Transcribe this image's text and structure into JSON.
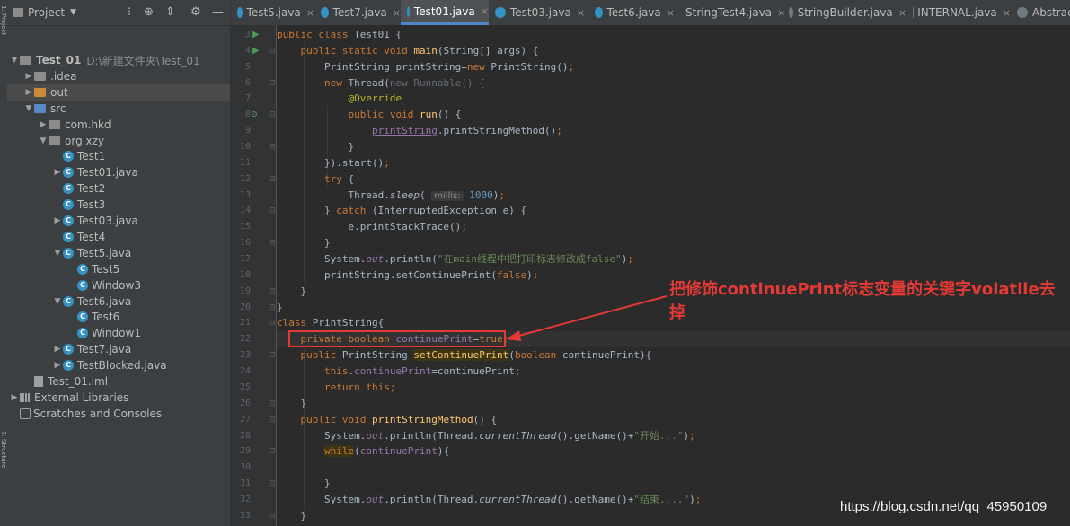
{
  "project_panel": {
    "title": "Project",
    "tree": [
      {
        "label": "Test_01",
        "path": "D:\\新建文件夹\\Test_01",
        "bold": true,
        "depth": 0,
        "expanded": true,
        "icon": "folder-grey"
      },
      {
        "label": ".idea",
        "depth": 1,
        "expanded": false,
        "icon": "folder-grey"
      },
      {
        "label": "out",
        "depth": 1,
        "expanded": false,
        "icon": "folder-orange",
        "selected": true
      },
      {
        "label": "src",
        "depth": 1,
        "expanded": true,
        "icon": "folder-blue"
      },
      {
        "label": "com.hkd",
        "depth": 2,
        "expanded": false,
        "icon": "package"
      },
      {
        "label": "org.xzy",
        "depth": 2,
        "expanded": true,
        "icon": "package"
      },
      {
        "label": "Test1",
        "depth": 3,
        "icon": "class"
      },
      {
        "label": "Test01.java",
        "depth": 3,
        "expanded": false,
        "icon": "class"
      },
      {
        "label": "Test2",
        "depth": 3,
        "icon": "class"
      },
      {
        "label": "Test3",
        "depth": 3,
        "icon": "class"
      },
      {
        "label": "Test03.java",
        "depth": 3,
        "expanded": false,
        "icon": "class"
      },
      {
        "label": "Test4",
        "depth": 3,
        "icon": "class"
      },
      {
        "label": "Test5.java",
        "depth": 3,
        "expanded": true,
        "icon": "class"
      },
      {
        "label": "Test5",
        "depth": 4,
        "icon": "class"
      },
      {
        "label": "Window3",
        "depth": 4,
        "icon": "class"
      },
      {
        "label": "Test6.java",
        "depth": 3,
        "expanded": true,
        "icon": "class"
      },
      {
        "label": "Test6",
        "depth": 4,
        "icon": "class"
      },
      {
        "label": "Window1",
        "depth": 4,
        "icon": "class"
      },
      {
        "label": "Test7.java",
        "depth": 3,
        "expanded": false,
        "icon": "class"
      },
      {
        "label": "TestBlocked.java",
        "depth": 3,
        "expanded": false,
        "icon": "class"
      },
      {
        "label": "Test_01.iml",
        "depth": 1,
        "icon": "iml"
      },
      {
        "label": "External Libraries",
        "depth": 0,
        "expanded": false,
        "icon": "library"
      },
      {
        "label": "Scratches and Consoles",
        "depth": 0,
        "icon": "scratches"
      }
    ]
  },
  "tabs": [
    {
      "label": "Test5.java",
      "active": false
    },
    {
      "label": "Test7.java",
      "active": false
    },
    {
      "label": "Test01.java",
      "active": true
    },
    {
      "label": "Test03.java",
      "active": false
    },
    {
      "label": "Test6.java",
      "active": false
    },
    {
      "label": "StringTest4.java",
      "active": false
    },
    {
      "label": "StringBuilder.java",
      "active": false
    },
    {
      "label": "INTERNAL.java",
      "active": false
    },
    {
      "label": "Abstract",
      "active": false
    }
  ],
  "editor": {
    "current_line": 22,
    "lines": [
      {
        "n": 3,
        "html": "<span class=\"kw\">public class </span>Test01 {"
      },
      {
        "n": 4,
        "html": "    <span class=\"kw\">public static void </span><span class=\"mth\">main</span>(String[] args) {"
      },
      {
        "n": 5,
        "html": "        PrintString printString=<span class=\"kw\">new </span>PrintString()<span class=\"kw\">;</span>"
      },
      {
        "n": 6,
        "html": "        <span class=\"kw\">new </span>Thread(<span class=\"dim\">new Runnable() {</span>"
      },
      {
        "n": 7,
        "html": "            <span class=\"ann\">@Override</span>"
      },
      {
        "n": 8,
        "html": "            <span class=\"kw\">public void </span><span class=\"mth\">run</span>() {"
      },
      {
        "n": 9,
        "html": "                <span class=\"fld u\">printString</span>.printStringMethod()<span class=\"kw\">;</span>"
      },
      {
        "n": 10,
        "html": "            }"
      },
      {
        "n": 11,
        "html": "        }).start()<span class=\"kw\">;</span>"
      },
      {
        "n": 12,
        "html": "        <span class=\"kw\">try </span>{"
      },
      {
        "n": 13,
        "html": "            Thread.<span class=\"it\">sleep</span>( <span class=\"hint\">millis:</span> <span style=\"color:#6897bb\">1000</span>)<span class=\"kw\">;</span>"
      },
      {
        "n": 14,
        "html": "        } <span class=\"kw\">catch </span>(InterruptedException e) {"
      },
      {
        "n": 15,
        "html": "            e.printStackTrace()<span class=\"kw\">;</span>"
      },
      {
        "n": 16,
        "html": "        }"
      },
      {
        "n": 17,
        "html": "        System.<span class=\"fld it\">out</span>.println(<span class=\"str\">\"在main线程中把打印标志修改成false\"</span>)<span class=\"kw\">;</span>"
      },
      {
        "n": 18,
        "html": "        printString.setContinuePrint(<span class=\"kw\">false</span>)<span class=\"kw\">;</span>"
      },
      {
        "n": 19,
        "html": "    }"
      },
      {
        "n": 20,
        "html": "}"
      },
      {
        "n": 21,
        "html": "<span class=\"kw\">class </span>PrintString{"
      },
      {
        "n": 22,
        "html": "    <span class=\"kw\">private boolean </span><span class=\"fld\">continuePrint</span>=<span class=\"kw\">true;</span>"
      },
      {
        "n": 23,
        "html": "    <span class=\"kw\">public </span>PrintString <span class=\"mth hl\">setContinuePrint</span>(<span class=\"kw\">boolean </span>continuePrint){"
      },
      {
        "n": 24,
        "html": "        <span class=\"kw\">this</span>.<span class=\"fld\">continuePrint</span>=continuePrint<span class=\"kw\">;</span>"
      },
      {
        "n": 25,
        "html": "        <span class=\"kw\">return this;</span>"
      },
      {
        "n": 26,
        "html": "    }"
      },
      {
        "n": 27,
        "html": "    <span class=\"kw\">public void </span><span class=\"mth\">printStringMethod</span>() {"
      },
      {
        "n": 28,
        "html": "        System.<span class=\"fld it\">out</span>.println(Thread.<span class=\"it\">currentThread</span>().getName()+<span class=\"str\">\"开始...\"</span>)<span class=\"kw\">;</span>"
      },
      {
        "n": 29,
        "html": "        <span class=\"kw hl\">while</span>(<span class=\"fld\">continuePrint</span>){"
      },
      {
        "n": 30,
        "html": ""
      },
      {
        "n": 31,
        "html": "        }"
      },
      {
        "n": 32,
        "html": "        System.<span class=\"fld it\">out</span>.println(Thread.<span class=\"it\">currentThread</span>().getName()+<span class=\"str\">\"结束....\"</span>)<span class=\"kw\">;</span>"
      },
      {
        "n": 33,
        "html": "    }"
      }
    ]
  },
  "annotation": {
    "text": "把修饰continuePrint标志变量的关键字volatile去掉",
    "color": "#e53935"
  },
  "watermark": "https://blog.csdn.net/qq_45950109",
  "colors": {
    "keyword": "#cc7832",
    "field": "#9876aa",
    "string": "#6a8759",
    "annotation": "#bbb529",
    "method": "#ffc66d",
    "accent": "#4a88c7"
  }
}
